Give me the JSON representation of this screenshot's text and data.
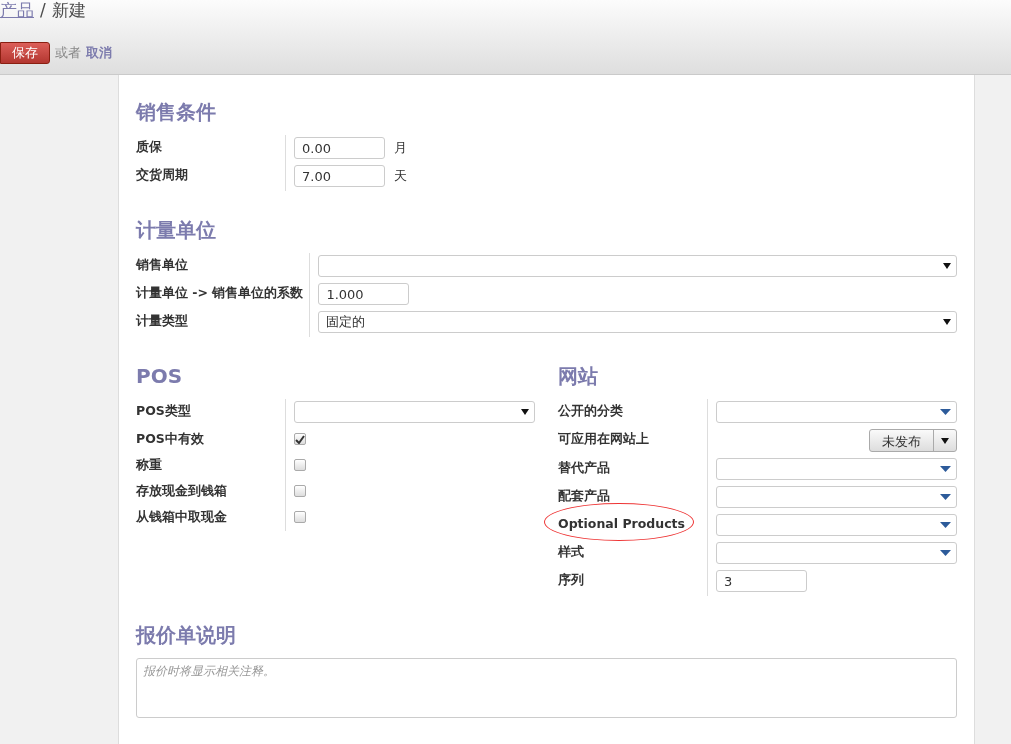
{
  "breadcrumb": [
    {
      "label": "产品",
      "kind": "link"
    },
    {
      "label": "/",
      "kind": "separator"
    },
    {
      "label": "新建",
      "kind": "current"
    }
  ],
  "actions": {
    "save": "保存",
    "or": "或者",
    "cancel": "取消"
  },
  "sections": [
    {
      "kind": "single",
      "title": "销售条件",
      "fields": [
        {
          "label": "质保",
          "kind": "number",
          "value": "0.00",
          "unit": "月"
        },
        {
          "label": "交货周期",
          "kind": "number",
          "value": "7.00",
          "unit": "天"
        }
      ]
    },
    {
      "kind": "single",
      "title": "计量单位",
      "fields": [
        {
          "label": "销售单位",
          "kind": "select"
        },
        {
          "label": "计量单位 -> 销售单位的系数",
          "kind": "number",
          "value": "1.000"
        },
        {
          "label": "计量类型",
          "kind": "select",
          "value": "固定的"
        }
      ]
    },
    {
      "kind": "pair",
      "columns": [
        {
          "title": "POS",
          "fields": [
            {
              "label": "POS类型",
              "kind": "select"
            },
            {
              "label": "POS中有效",
              "kind": "checkbox",
              "checked": true
            },
            {
              "label": "称重",
              "kind": "checkbox",
              "checked": false
            },
            {
              "label": "存放现金到钱箱",
              "kind": "checkbox",
              "checked": false
            },
            {
              "label": "从钱箱中取现金",
              "kind": "checkbox",
              "checked": false
            }
          ]
        },
        {
          "title": "网站",
          "fields": [
            {
              "label": "公开的分类",
              "kind": "many2one"
            },
            {
              "label": "可应用在网站上",
              "kind": "toggle",
              "value": "未发布"
            },
            {
              "label": "替代产品",
              "kind": "many2one"
            },
            {
              "label": "配套产品",
              "kind": "many2one"
            },
            {
              "label": "Optional Products",
              "kind": "many2one",
              "highlighted": true
            },
            {
              "label": "样式",
              "kind": "many2one"
            },
            {
              "label": "序列",
              "kind": "number",
              "value": "3"
            }
          ]
        }
      ]
    },
    {
      "kind": "note",
      "title": "报价单说明",
      "placeholder": "报价时将显示相关注释。"
    }
  ]
}
